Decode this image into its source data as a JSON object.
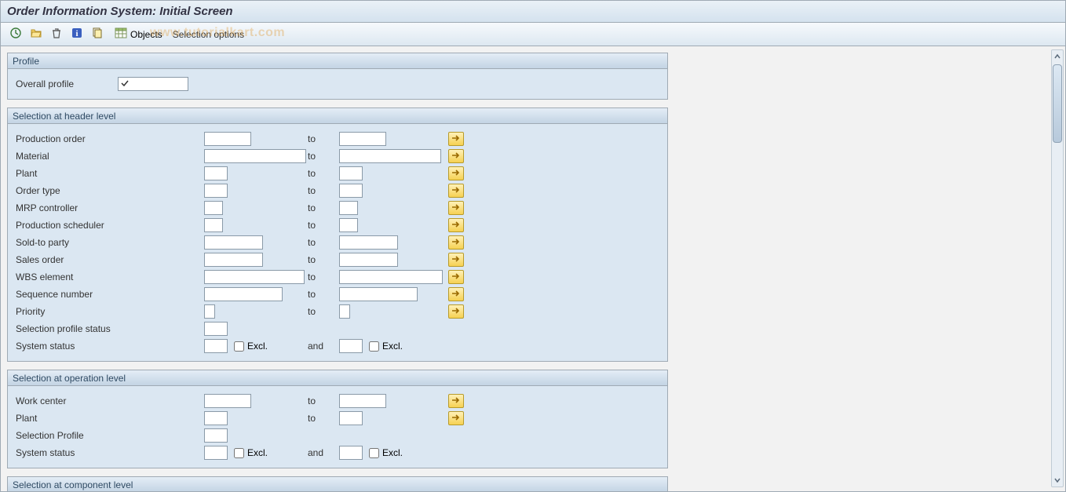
{
  "title": "Order Information System: Initial Screen",
  "watermark": "www.tutorialkart.com",
  "toolbar": {
    "objects_label": "Objects",
    "selection_options_label": "Selection options"
  },
  "panels": {
    "profile": {
      "title": "Profile",
      "overall_profile_label": "Overall profile",
      "overall_profile_value": ""
    },
    "header": {
      "title": "Selection at header level",
      "rows": {
        "production_order": {
          "label": "Production order",
          "to": "to"
        },
        "material": {
          "label": "Material",
          "to": "to"
        },
        "plant": {
          "label": "Plant",
          "to": "to"
        },
        "order_type": {
          "label": "Order type",
          "to": "to"
        },
        "mrp_controller": {
          "label": "MRP controller",
          "to": "to"
        },
        "production_scheduler": {
          "label": "Production scheduler",
          "to": "to"
        },
        "sold_to_party": {
          "label": "Sold-to party",
          "to": "to"
        },
        "sales_order": {
          "label": "Sales order",
          "to": "to"
        },
        "wbs_element": {
          "label": "WBS element",
          "to": "to"
        },
        "sequence_number": {
          "label": "Sequence number",
          "to": "to"
        },
        "priority": {
          "label": "Priority",
          "to": "to"
        },
        "selection_profile_status": {
          "label": "Selection profile status"
        },
        "system_status": {
          "label": "System status",
          "excl": "Excl.",
          "and": "and"
        }
      }
    },
    "operation": {
      "title": "Selection at operation level",
      "rows": {
        "work_center": {
          "label": "Work center",
          "to": "to"
        },
        "plant": {
          "label": "Plant",
          "to": "to"
        },
        "selection_profile": {
          "label": "Selection Profile"
        },
        "system_status": {
          "label": "System status",
          "excl": "Excl.",
          "and": "and"
        }
      }
    },
    "component": {
      "title": "Selection at component level"
    }
  }
}
